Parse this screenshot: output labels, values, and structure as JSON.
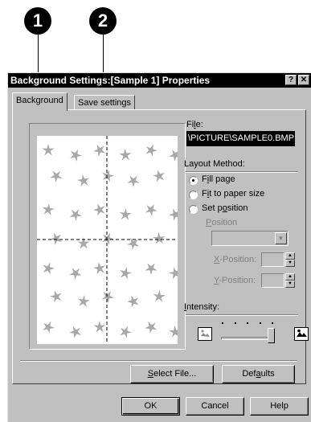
{
  "callouts": [
    "1",
    "2"
  ],
  "window": {
    "title": "Background Settings:[Sample 1] Properties",
    "help_button": "?",
    "close_button": "✕"
  },
  "tabs": [
    {
      "label": "Background",
      "active": true
    },
    {
      "label": "Save settings",
      "active": false
    }
  ],
  "file": {
    "label_pre": "Fi",
    "label_u": "l",
    "label_post": "e:",
    "value": "\\PICTURE\\SAMPLE0.BMP"
  },
  "layout_method": {
    "label": "Layout Method:",
    "options": [
      {
        "pre": "F",
        "u": "i",
        "post": "ll page",
        "selected": true
      },
      {
        "pre": "F",
        "u": "i",
        "post": "t to paper size",
        "selected": false
      },
      {
        "pre": "Set p",
        "u": "o",
        "post": "sition",
        "selected": false
      }
    ]
  },
  "position": {
    "label_pre": "",
    "label_u": "P",
    "label_post": "osition",
    "value": "",
    "enabled": false
  },
  "x_position": {
    "label_pre": "",
    "label_u": "X",
    "label_post": "-Position:",
    "value": ""
  },
  "y_position": {
    "label_pre": "",
    "label_u": "Y",
    "label_post": "-Position:",
    "value": ""
  },
  "intensity": {
    "label_pre": "",
    "label_u": "I",
    "label_post": "ntensity:",
    "level": 1.0,
    "low_icon": "picture-light-icon",
    "high_icon": "picture-dark-icon"
  },
  "buttons": {
    "select_file_pre": "",
    "select_file_u": "S",
    "select_file_post": "elect File...",
    "defaults_pre": "Def",
    "defaults_u": "a",
    "defaults_post": "ults",
    "ok": "OK",
    "cancel": "Cancel",
    "help": "Help"
  },
  "colors": {
    "dialog_face": "#c0c0c0",
    "title_bar": "#000000",
    "field_highlight": "#000000",
    "pattern_stars": "#a8a8a8"
  }
}
